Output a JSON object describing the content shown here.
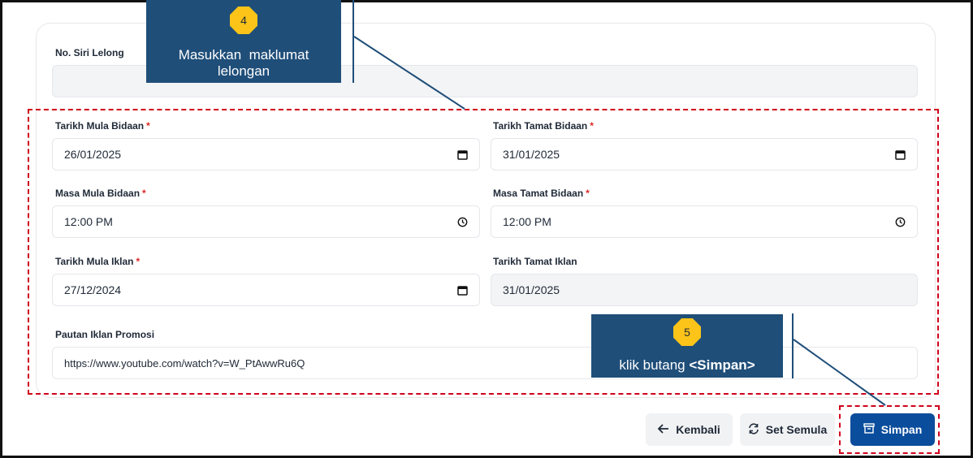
{
  "form": {
    "no_siri": {
      "label": "No. Siri Lelong",
      "value": ""
    },
    "tarikh_mula_bidaan": {
      "label": "Tarikh Mula Bidaan",
      "required": "*",
      "value": "26/01/2025"
    },
    "tarikh_tamat_bidaan": {
      "label": "Tarikh Tamat Bidaan",
      "required": "*",
      "value": "31/01/2025"
    },
    "masa_mula_bidaan": {
      "label": "Masa Mula Bidaan",
      "required": "*",
      "value": "12:00 PM"
    },
    "masa_tamat_bidaan": {
      "label": "Masa Tamat Bidaan",
      "required": "*",
      "value": "12:00 PM"
    },
    "tarikh_mula_iklan": {
      "label": "Tarikh Mula Iklan",
      "required": "*",
      "value": "27/12/2024"
    },
    "tarikh_tamat_iklan": {
      "label": "Tarikh Tamat Iklan",
      "value": "31/01/2025"
    },
    "pautan_iklan": {
      "label": "Pautan Iklan Promosi",
      "value": "https://www.youtube.com/watch?v=W_PtAwwRu6Q"
    }
  },
  "buttons": {
    "kembali": "Kembali",
    "set_semula": "Set Semula",
    "simpan": "Simpan"
  },
  "callouts": {
    "step4": {
      "number": "4",
      "text_line1": "Masukkan  maklumat",
      "text_line2": "lelongan"
    },
    "step5": {
      "number": "5",
      "text_prefix": "klik butang ",
      "text_bold": "<Simpan>"
    }
  },
  "colors": {
    "accent": "#0a4d9c",
    "callout": "#1f4e79",
    "badge": "#fcc419",
    "highlight": "#d0021b",
    "required": "#dc2626"
  },
  "icons": {
    "date": "calendar-icon",
    "time": "clock-icon",
    "back": "arrow-left-icon",
    "reset": "refresh-icon",
    "save": "archive-icon"
  }
}
